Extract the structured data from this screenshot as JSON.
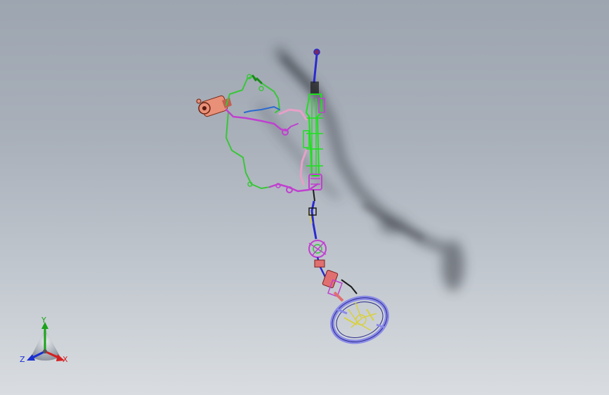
{
  "viewport": {
    "background_top": "#9da5b0",
    "background_bottom": "#d9dde1"
  },
  "model": {
    "colors": {
      "rack": "#1ee01e",
      "hose_green": "#39c63a",
      "hose_magenta": "#c040d0",
      "hose_pink": "#e6a0c8",
      "pump": "#e89078",
      "shaft_blue": "#2a2ad0",
      "column_pink": "#e07070",
      "wheel_blue": "#8a8ae8",
      "wheel_yellow": "#d8d040",
      "shadow": "#3a3f47"
    }
  },
  "triad": {
    "y_label": "Y",
    "z_label": "Z",
    "x_label": "X",
    "colors": {
      "y": "#1aa31a",
      "z": "#1a2fd1",
      "x": "#d42020"
    }
  }
}
